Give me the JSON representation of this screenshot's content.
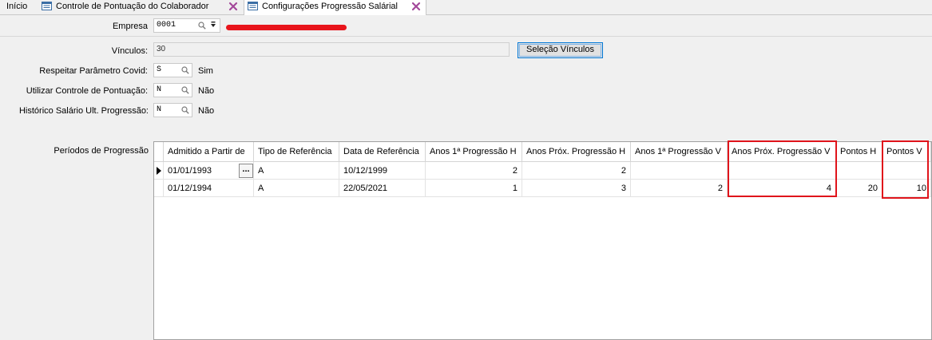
{
  "tabs": [
    {
      "label": "Início"
    },
    {
      "label": "Controle de Pontuação do Colaborador"
    },
    {
      "label": "Configurações Progressão Salárial"
    }
  ],
  "form": {
    "empresa_label": "Empresa",
    "empresa_value": "0001",
    "vinculos_label": "Vínculos:",
    "vinculos_value": "30",
    "selecao_button": "Seleção Vínculos",
    "covid_label": "Respeitar Parâmetro Covid:",
    "covid_value": "S",
    "covid_desc": "Sim",
    "pontuacao_label": "Utilizar Controle de Pontuação:",
    "pontuacao_value": "N",
    "pontuacao_desc": "Não",
    "historico_label": "Histórico Salário Ult. Progressão:",
    "historico_value": "N",
    "historico_desc": "Não"
  },
  "grid": {
    "section_label": "Períodos de Progressão",
    "columns": [
      "Admitido a Partir de",
      "Tipo de Referência",
      "Data de Referência",
      "Anos 1ª Progressão H",
      "Anos Próx. Progressão H",
      "Anos 1ª Progressão V",
      "Anos Próx. Progressão V",
      "Pontos H",
      "Pontos V"
    ],
    "rows": [
      [
        "01/01/1993",
        "A",
        "10/12/1999",
        "2",
        "2",
        "",
        "",
        "",
        ""
      ],
      [
        "01/12/1994",
        "A",
        "22/05/2021",
        "1",
        "3",
        "2",
        "4",
        "20",
        "10"
      ]
    ],
    "ellipsis_label": "..."
  },
  "colors": {
    "highlight": "#e0141b",
    "redaction": "#e8141b",
    "focus_border": "#0078d7"
  }
}
